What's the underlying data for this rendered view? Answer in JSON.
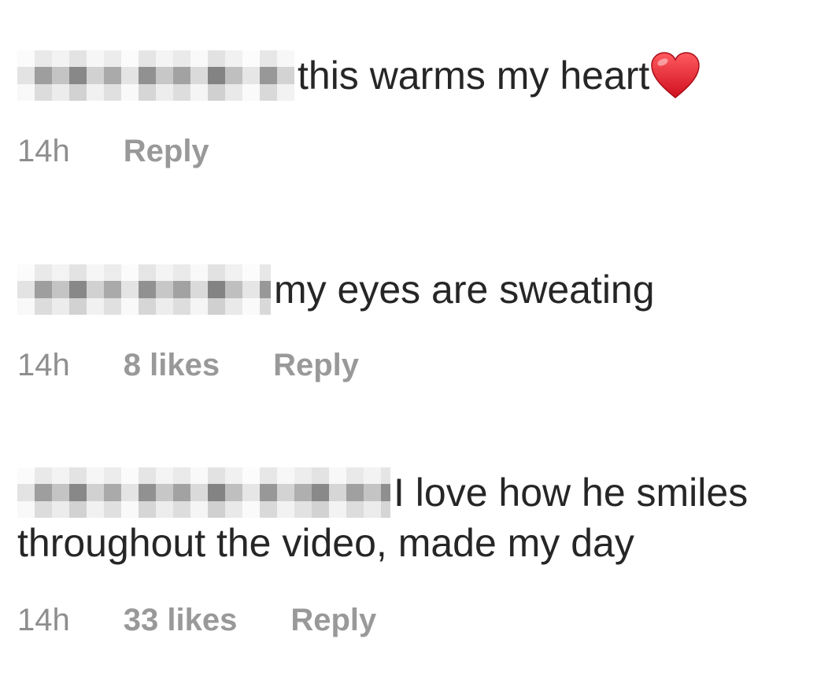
{
  "comments": [
    {
      "text": "this warms my heart",
      "emoji": "heart-icon",
      "time": "14h",
      "likes": "",
      "reply": "Reply"
    },
    {
      "text": "my eyes are sweating",
      "time": "14h",
      "likes": "8 likes",
      "reply": "Reply"
    },
    {
      "text": "I love how he smiles throughout the video, made my day",
      "time": "14h",
      "likes": "33 likes",
      "reply": "Reply"
    }
  ],
  "colors": {
    "text": "#262626",
    "meta": "#8e8e8e",
    "heart": "#e0202f"
  }
}
